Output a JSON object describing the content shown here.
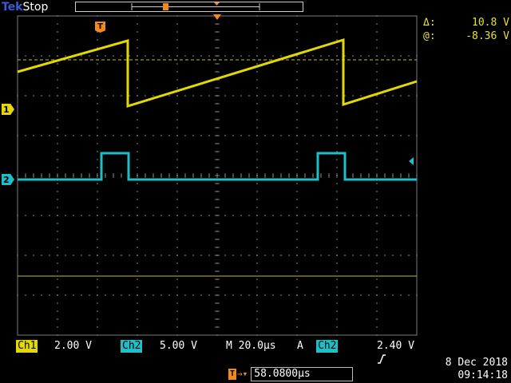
{
  "top_bar": {
    "brand": "Tek",
    "acquisition_state": "Stop"
  },
  "cursor_readout": {
    "delta_label": "Δ:",
    "delta_value": "10.8 V",
    "at_label": "@:",
    "at_value": "-8.36 V"
  },
  "channel_markers": {
    "ch1": "1",
    "ch2": "2"
  },
  "trigger_marker": "T",
  "status_bar": {
    "ch1_label": "Ch1",
    "ch1_scale": "2.00 V",
    "ch2_label": "Ch2",
    "ch2_scale": "5.00 V",
    "timebase": "M 20.0µs",
    "trigger_mode": "A",
    "trigger_source": "Ch2",
    "trigger_slope_icon": "rising-edge-icon",
    "trigger_level": "2.40 V"
  },
  "datetime": {
    "date": "8 Dec  2018",
    "time": "09:14:18"
  },
  "trigger_position": {
    "badge": "T",
    "value": "58.0800µs"
  },
  "colors": {
    "ch1": "#e3d800",
    "ch2": "#1ec0c8",
    "trigger": "#f08a20",
    "grid": "#7a7a7a"
  }
}
